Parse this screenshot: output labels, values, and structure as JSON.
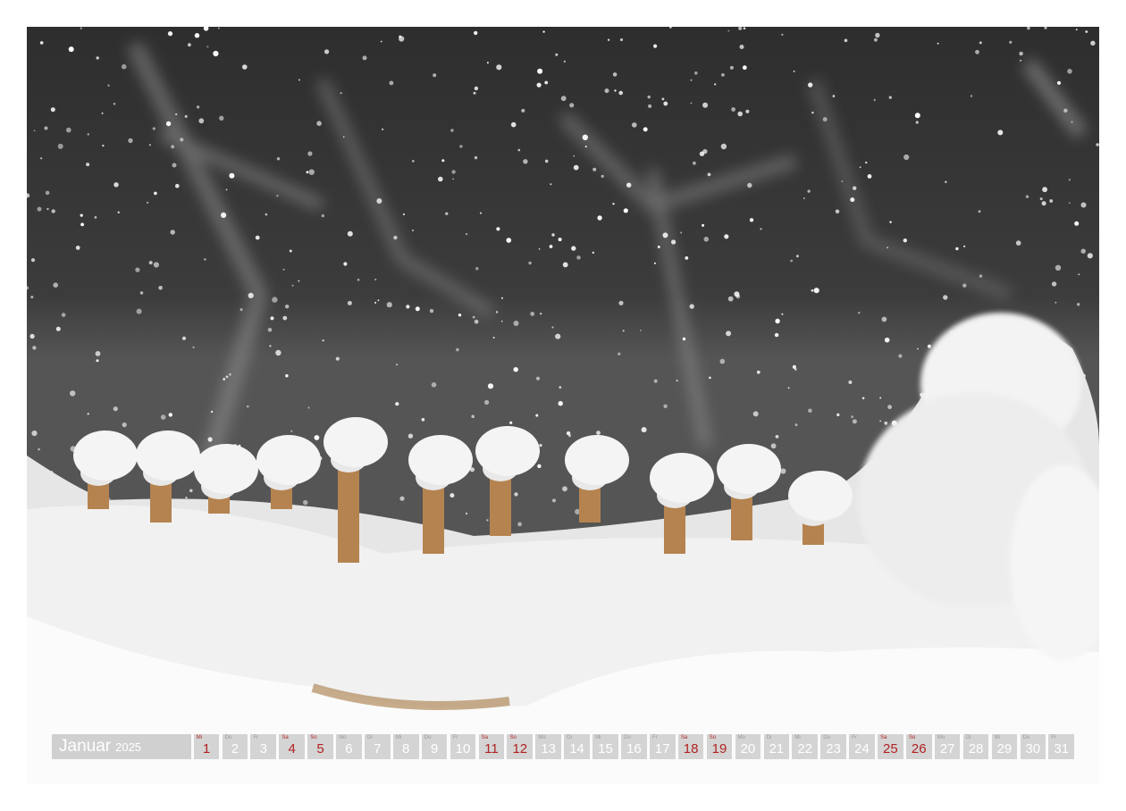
{
  "calendar": {
    "month": "Januar",
    "year": "2025",
    "days": [
      {
        "wd": "Mi",
        "n": "1",
        "we": true
      },
      {
        "wd": "Do",
        "n": "2",
        "we": false
      },
      {
        "wd": "Fr",
        "n": "3",
        "we": false
      },
      {
        "wd": "Sa",
        "n": "4",
        "we": true
      },
      {
        "wd": "So",
        "n": "5",
        "we": true
      },
      {
        "wd": "Mo",
        "n": "6",
        "we": false
      },
      {
        "wd": "Di",
        "n": "7",
        "we": false
      },
      {
        "wd": "Mi",
        "n": "8",
        "we": false
      },
      {
        "wd": "Do",
        "n": "9",
        "we": false
      },
      {
        "wd": "Fr",
        "n": "10",
        "we": false
      },
      {
        "wd": "Sa",
        "n": "11",
        "we": true
      },
      {
        "wd": "So",
        "n": "12",
        "we": true
      },
      {
        "wd": "Mo",
        "n": "13",
        "we": false
      },
      {
        "wd": "Di",
        "n": "14",
        "we": false
      },
      {
        "wd": "Mi",
        "n": "15",
        "we": false
      },
      {
        "wd": "Do",
        "n": "16",
        "we": false
      },
      {
        "wd": "Fr",
        "n": "17",
        "we": false
      },
      {
        "wd": "Sa",
        "n": "18",
        "we": true
      },
      {
        "wd": "So",
        "n": "19",
        "we": true
      },
      {
        "wd": "Mo",
        "n": "20",
        "we": false
      },
      {
        "wd": "Di",
        "n": "21",
        "we": false
      },
      {
        "wd": "Mi",
        "n": "22",
        "we": false
      },
      {
        "wd": "Do",
        "n": "23",
        "we": false
      },
      {
        "wd": "Fr",
        "n": "24",
        "we": false
      },
      {
        "wd": "Sa",
        "n": "25",
        "we": true
      },
      {
        "wd": "So",
        "n": "26",
        "we": true
      },
      {
        "wd": "Mo",
        "n": "27",
        "we": false
      },
      {
        "wd": "Di",
        "n": "28",
        "we": false
      },
      {
        "wd": "Mi",
        "n": "29",
        "we": false
      },
      {
        "wd": "Do",
        "n": "30",
        "we": false
      },
      {
        "wd": "Fr",
        "n": "31",
        "we": false
      }
    ]
  },
  "colors": {
    "holiday": "#b22222",
    "cell": "#cdcdcd",
    "text": "#ffffff"
  }
}
